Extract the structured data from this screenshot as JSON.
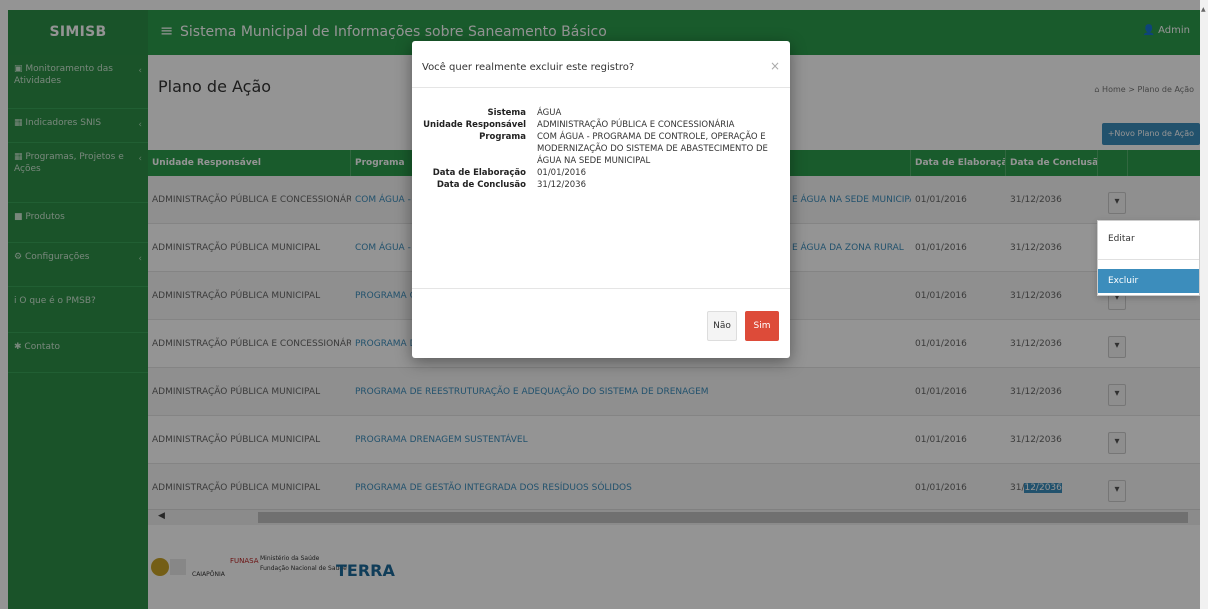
{
  "app": {
    "brand": "SIMISB",
    "menu_icon": "hamburger-icon",
    "system_title": "Sistema Municipal de Informações sobre Saneamento Básico",
    "user_label": "Admin"
  },
  "sidebar": {
    "items": [
      {
        "label": "Monitoramento das Atividades",
        "icon": "dashboard-icon",
        "has_children": true
      },
      {
        "label": "Indicadores SNIS",
        "icon": "table-icon",
        "has_children": true
      },
      {
        "label": "Programas, Projetos e Ações",
        "icon": "table-icon",
        "has_children": true
      },
      {
        "label": "Produtos",
        "icon": "folder-icon",
        "has_children": false
      },
      {
        "label": "Configurações",
        "icon": "gear-icon",
        "has_children": true
      },
      {
        "label": "O que é o PMSB?",
        "icon": "info-icon",
        "has_children": false
      },
      {
        "label": "Contato",
        "icon": "users-icon",
        "has_children": false
      }
    ]
  },
  "page": {
    "title": "Plano de Ação",
    "breadcrumb": [
      "Home",
      "Plano de Ação"
    ],
    "new_button": "+Novo Plano de Ação"
  },
  "table": {
    "headers": [
      "Unidade Responsável",
      "Programa",
      "Data de Elaboração",
      "Data de Conclusão"
    ],
    "rows": [
      {
        "unidade": "ADMINISTRAÇÃO PÚBLICA E CONCESSIONÁRIA",
        "programa": "COM ÁGUA - PROGRAMA DE CONTROLE, OPERAÇÃO E MODERNIZAÇÃO DO SISTEMA DE ABASTECIMENTO DE ÁGUA NA SEDE MUNICIPAL",
        "programa_start": "COM ÁGUA -",
        "programa_end": "E ÁGUA NA SEDE MUNICIPAL",
        "elaboracao": "01/01/2016",
        "conclusao": "31/12/2036"
      },
      {
        "unidade": "ADMINISTRAÇÃO PÚBLICA MUNICIPAL",
        "programa": "COM ÁGUA - ABASTECIMENTO DE ÁGUA DA ZONA RURAL",
        "programa_start": "COM ÁGUA -",
        "programa_end": "E ÁGUA DA ZONA RURAL",
        "elaboracao": "01/01/2016",
        "conclusao": "31/12/2036"
      },
      {
        "unidade": "ADMINISTRAÇÃO PÚBLICA MUNICIPAL",
        "programa": "PROGRAMA G",
        "programa_start": "PROGRAMA G",
        "programa_end": "",
        "elaboracao": "01/01/2016",
        "conclusao": "31/12/2036"
      },
      {
        "unidade": "ADMINISTRAÇÃO PÚBLICA E CONCESSIONÁRIA",
        "programa": "PROGRAMA D",
        "programa_start": "PROGRAMA D",
        "programa_end": "",
        "elaboracao": "01/01/2016",
        "conclusao": "31/12/2036"
      },
      {
        "unidade": "ADMINISTRAÇÃO PÚBLICA MUNICIPAL",
        "programa": "PROGRAMA DE REESTRUTURAÇÃO E ADEQUAÇÃO DO SISTEMA DE DRENAGEM",
        "programa_start": "PROGRAMA DE REESTRUTURAÇÃO E ADEQUAÇÃO DO SISTEMA DE DRENAGEM",
        "programa_end": "",
        "elaboracao": "01/01/2016",
        "conclusao": "31/12/2036"
      },
      {
        "unidade": "ADMINISTRAÇÃO PÚBLICA MUNICIPAL",
        "programa": "PROGRAMA DRENAGEM SUSTENTÁVEL",
        "programa_start": "PROGRAMA DRENAGEM SUSTENTÁVEL",
        "programa_end": "",
        "elaboracao": "01/01/2016",
        "conclusao": "31/12/2036"
      },
      {
        "unidade": "ADMINISTRAÇÃO PÚBLICA MUNICIPAL",
        "programa": "PROGRAMA DE GESTÃO INTEGRADA DOS RESÍDUOS SÓLIDOS",
        "programa_start": "PROGRAMA DE GESTÃO INTEGRADA DOS RESÍDUOS SÓLIDOS",
        "programa_end": "",
        "elaboracao": "01/01/2016",
        "conclusao_a": "31/",
        "conclusao_b": "12/2036"
      }
    ],
    "action_glyph": "▾"
  },
  "dropdown": {
    "items": [
      "Editar",
      "Excluir"
    ],
    "selected": "Excluir"
  },
  "modal": {
    "title": "Você quer realmente excluir este registro?",
    "close_glyph": "×",
    "fields": [
      {
        "label": "Sistema",
        "value": "ÁGUA"
      },
      {
        "label": "Unidade Responsável",
        "value": "ADMINISTRAÇÃO PÚBLICA E CONCESSIONÁRIA"
      },
      {
        "label": "Programa",
        "value": "COM ÁGUA - PROGRAMA DE CONTROLE, OPERAÇÃO E MODERNIZAÇÃO DO SISTEMA DE ABASTECIMENTO DE ÁGUA NA SEDE MUNICIPAL"
      },
      {
        "label": "Data de Elaboração",
        "value": "01/01/2016"
      },
      {
        "label": "Data de Conclusão",
        "value": "31/12/2036"
      }
    ],
    "no_button": "Não",
    "yes_button": "Sim"
  },
  "footer": {
    "logo_caiapona": "CAIAPÔNIA",
    "logo_funasa": "FUNASA",
    "logo_ministerio": "Ministério da Saúde",
    "logo_fundacao": "Fundação Nacional de Saúde",
    "logo_terra": "TERRA"
  },
  "colors": {
    "brand_green": "#2c9d4d",
    "link_blue": "#3c8dbc",
    "danger_red": "#dd4b39"
  }
}
